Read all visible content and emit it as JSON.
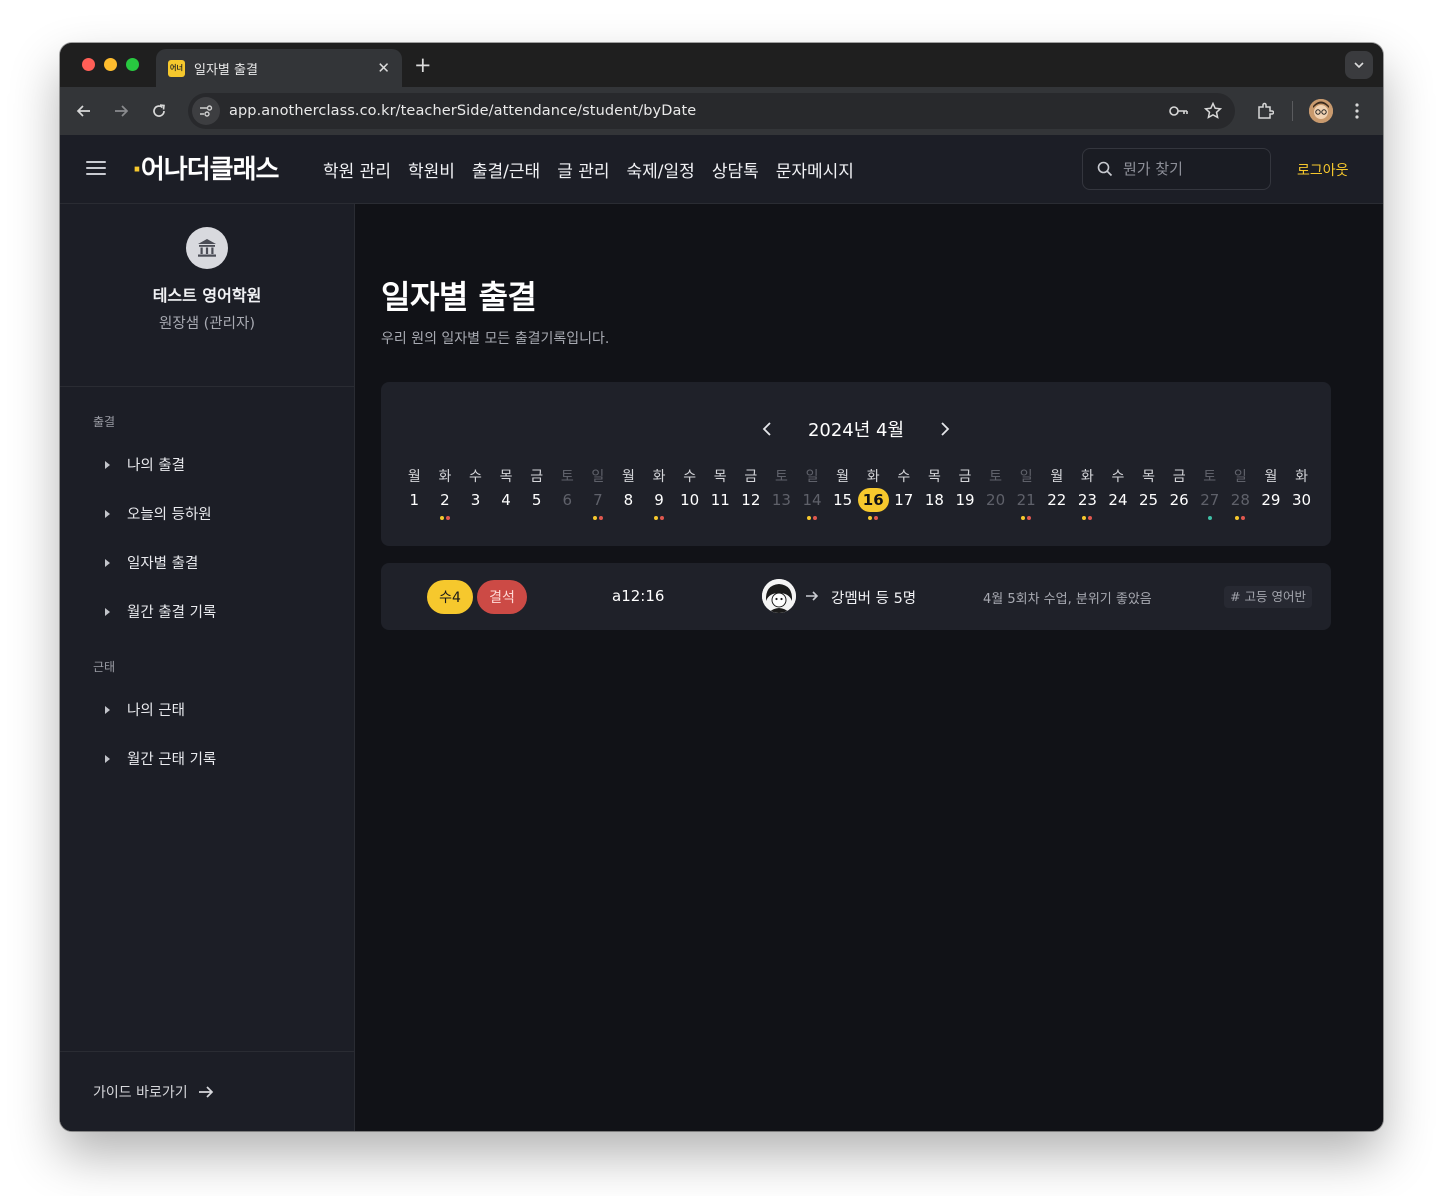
{
  "browser": {
    "tab_title": "일자별 출결",
    "tab_favicon_text": "어너",
    "url": "app.anotherclass.co.kr/teacherSide/attendance/student/byDate"
  },
  "header": {
    "logo_text": "어나더클래스",
    "nav": [
      "학원 관리",
      "학원비",
      "출결/근태",
      "글 관리",
      "숙제/일정",
      "상담톡",
      "문자메시지"
    ],
    "search_placeholder": "뭔가 찾기",
    "logout": "로그아웃"
  },
  "sidebar": {
    "academy_name": "테스트 영어학원",
    "role": "원장샘 (관리자)",
    "sections": [
      {
        "title": "출결",
        "items": [
          "나의 출결",
          "오늘의 등하원",
          "일자별 출결",
          "월간 출결 기록"
        ]
      },
      {
        "title": "근태",
        "items": [
          "나의 근태",
          "월간 근태 기록"
        ]
      }
    ],
    "guide_label": "가이드 바로가기"
  },
  "main": {
    "title": "일자별 출결",
    "description": "우리 원의 일자별 모든 출결기록입니다.",
    "month_label": "2024년 4월",
    "selected_day": 16,
    "days": [
      {
        "wd": "월",
        "d": "1",
        "weekend": false,
        "dots": []
      },
      {
        "wd": "화",
        "d": "2",
        "weekend": false,
        "dots": [
          "#f6c82d",
          "#e0584f"
        ]
      },
      {
        "wd": "수",
        "d": "3",
        "weekend": false,
        "dots": []
      },
      {
        "wd": "목",
        "d": "4",
        "weekend": false,
        "dots": []
      },
      {
        "wd": "금",
        "d": "5",
        "weekend": false,
        "dots": []
      },
      {
        "wd": "토",
        "d": "6",
        "weekend": true,
        "dots": []
      },
      {
        "wd": "일",
        "d": "7",
        "weekend": true,
        "dots": [
          "#f6c82d",
          "#e0584f"
        ]
      },
      {
        "wd": "월",
        "d": "8",
        "weekend": false,
        "dots": []
      },
      {
        "wd": "화",
        "d": "9",
        "weekend": false,
        "dots": [
          "#f6c82d",
          "#e0584f"
        ]
      },
      {
        "wd": "수",
        "d": "10",
        "weekend": false,
        "dots": []
      },
      {
        "wd": "목",
        "d": "11",
        "weekend": false,
        "dots": []
      },
      {
        "wd": "금",
        "d": "12",
        "weekend": false,
        "dots": []
      },
      {
        "wd": "토",
        "d": "13",
        "weekend": true,
        "dots": []
      },
      {
        "wd": "일",
        "d": "14",
        "weekend": true,
        "dots": [
          "#f6c82d",
          "#e0584f"
        ]
      },
      {
        "wd": "월",
        "d": "15",
        "weekend": false,
        "dots": []
      },
      {
        "wd": "화",
        "d": "16",
        "weekend": false,
        "dots": [
          "#f6c82d",
          "#e0584f"
        ]
      },
      {
        "wd": "수",
        "d": "17",
        "weekend": false,
        "dots": []
      },
      {
        "wd": "목",
        "d": "18",
        "weekend": false,
        "dots": []
      },
      {
        "wd": "금",
        "d": "19",
        "weekend": false,
        "dots": []
      },
      {
        "wd": "토",
        "d": "20",
        "weekend": true,
        "dots": []
      },
      {
        "wd": "일",
        "d": "21",
        "weekend": true,
        "dots": [
          "#f6c82d",
          "#e0584f"
        ]
      },
      {
        "wd": "월",
        "d": "22",
        "weekend": false,
        "dots": []
      },
      {
        "wd": "화",
        "d": "23",
        "weekend": false,
        "dots": [
          "#f6c82d",
          "#e0584f"
        ]
      },
      {
        "wd": "수",
        "d": "24",
        "weekend": false,
        "dots": []
      },
      {
        "wd": "목",
        "d": "25",
        "weekend": false,
        "dots": []
      },
      {
        "wd": "금",
        "d": "26",
        "weekend": false,
        "dots": []
      },
      {
        "wd": "토",
        "d": "27",
        "weekend": true,
        "dots": [
          "#3fbfa6"
        ]
      },
      {
        "wd": "일",
        "d": "28",
        "weekend": true,
        "dots": [
          "#f6c82d",
          "#e0584f"
        ]
      },
      {
        "wd": "월",
        "d": "29",
        "weekend": false,
        "dots": []
      },
      {
        "wd": "화",
        "d": "30",
        "weekend": false,
        "dots": []
      }
    ],
    "record": {
      "class_badge": "수4",
      "status_badge": "결석",
      "time": "a12:16",
      "members": "강멤버 등 5명",
      "note": "4월 5회차 수업, 분위기 좋았음",
      "tag": "# 고등 영어반"
    }
  },
  "colors": {
    "accent": "#f6c82d",
    "absent": "#cc4a45",
    "background": "#111217",
    "panel": "#1f2129"
  }
}
